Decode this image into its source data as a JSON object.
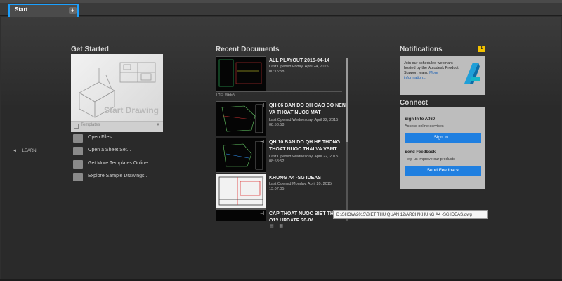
{
  "tabs": {
    "start_label": "Start",
    "new_tab": "+"
  },
  "get_started": {
    "heading": "Get Started",
    "start_drawing": "Start Drawing",
    "templates_label": "Templates",
    "actions": [
      {
        "label": "Open Files...",
        "icon": "folder-icon"
      },
      {
        "label": "Open a Sheet Set...",
        "icon": "sheet-set-icon"
      },
      {
        "label": "Get More Templates Online",
        "icon": "templates-online-icon"
      },
      {
        "label": "Explore Sample Drawings...",
        "icon": "sample-drawings-icon"
      }
    ]
  },
  "learn": {
    "label": "LEARN"
  },
  "recent": {
    "heading": "Recent Documents",
    "this_week": "THIS WEEK",
    "docs": [
      {
        "title": "ALL PLAYOUT 2015-04-14",
        "meta1": "Last Opened Friday, April 24, 2015",
        "meta2": "00:15:58"
      },
      {
        "title": "QH 06 BAN DO QH CAO DO NEN VA THOAT NUOC MAT",
        "meta1": "Last Opened Wednesday, April 22, 2015",
        "meta2": "08:58:58"
      },
      {
        "title": "QH 10 BAN DO QH HE THONG THOAT NUOC THAI VA VSMT",
        "meta1": "Last Opened Wednesday, April 22, 2015",
        "meta2": "08:58:52"
      },
      {
        "title": "KHUNG A4 -SG IDEAS",
        "meta1": "Last Opened Monday, April 20, 2015",
        "meta2": "13:07:05"
      },
      {
        "title": "CAP THOAT NUOC BIET THU Q12 UPDATE 20-04",
        "meta1": "",
        "meta2": ""
      }
    ],
    "tooltip": "D:\\SHOW\\2015\\BIET THU QUAN 12\\ARCH\\KHUNG A4 -SG IDEAS.dwg"
  },
  "notifications": {
    "heading": "Notifications",
    "count": "1",
    "text": "Join our scheduled webinars hosted by the Autodesk Product Support team.",
    "more": "More information..."
  },
  "connect": {
    "heading": "Connect",
    "sign_in_heading": "Sign In to A360",
    "sign_in_sub": "Access online services",
    "sign_in_btn": "Sign In...",
    "feedback_heading": "Send Feedback",
    "feedback_sub": "Help us improve our products",
    "feedback_btn": "Send Feedback"
  }
}
